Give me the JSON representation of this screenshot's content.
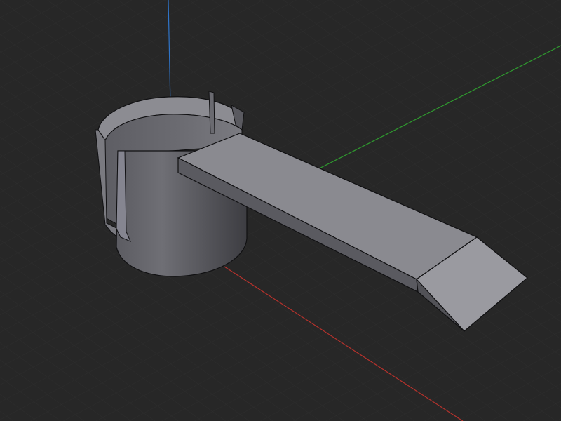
{
  "viewport": {
    "background": "#272727",
    "grid_color": "#303030",
    "grid_shown": true,
    "axes": {
      "x_color": "#b8322c",
      "y_color": "#2f9a2f",
      "z_color": "#2f74c8"
    }
  },
  "model": {
    "parts": [
      "split-cylindrical-sleeve",
      "flat-arm",
      "tapered-arm-tip"
    ],
    "colors": {
      "face_light": "#8a8a90",
      "face_mid": "#6f6f75",
      "face_dark": "#4c4c51",
      "edge": "#101012"
    }
  }
}
